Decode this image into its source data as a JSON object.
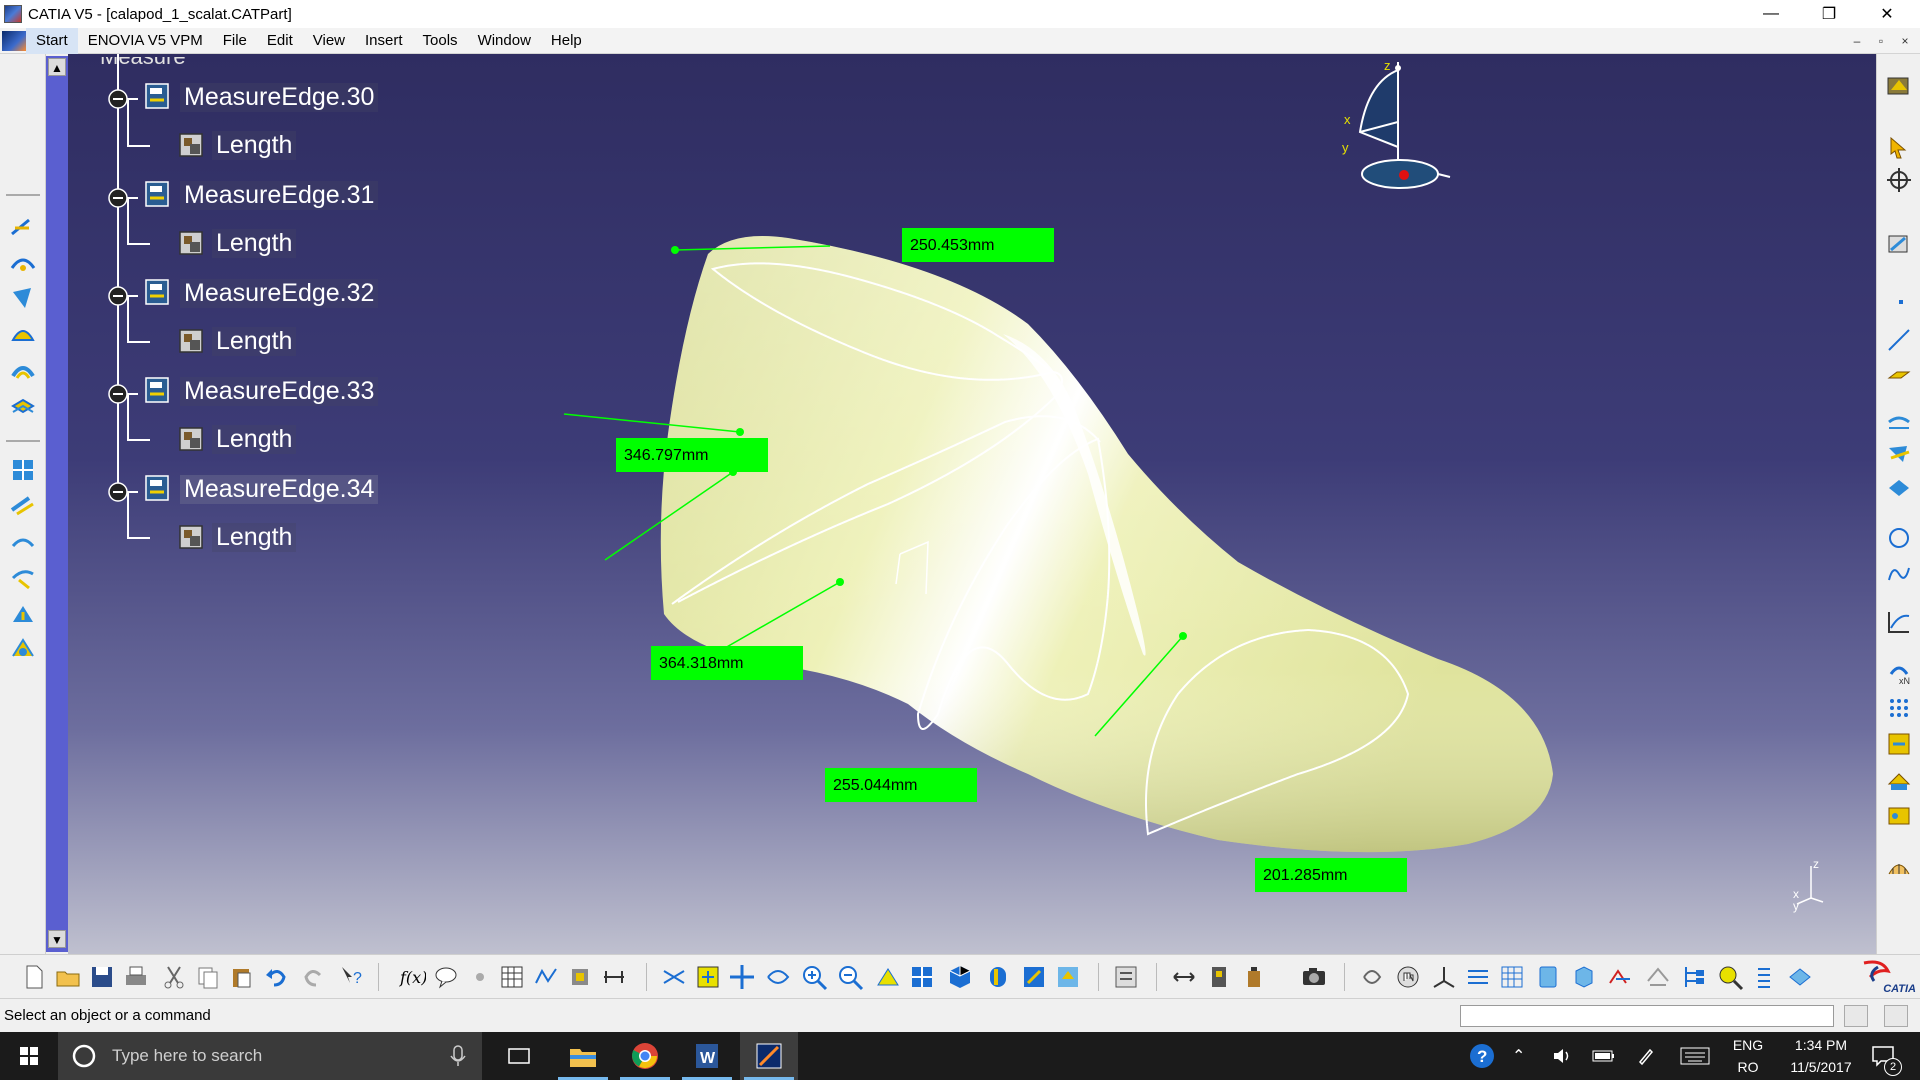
{
  "window": {
    "title": "CATIA V5 - [calapod_1_scalat.CATPart]",
    "controls": {
      "minimize": "—",
      "restore": "❐",
      "close": "✕"
    }
  },
  "menubar": {
    "items": [
      {
        "label": "Start",
        "active": true
      },
      {
        "label": "ENOVIA V5 VPM"
      },
      {
        "label": "File"
      },
      {
        "label": "Edit"
      },
      {
        "label": "View"
      },
      {
        "label": "Insert"
      },
      {
        "label": "Tools"
      },
      {
        "label": "Window"
      },
      {
        "label": "Help"
      }
    ],
    "doc_controls": {
      "minimize": "–",
      "restore": "▫",
      "close": "×"
    }
  },
  "spec_tree": {
    "partial_label": "Measure",
    "nodes": [
      {
        "label": "MeasureEdge.30",
        "child": "Length"
      },
      {
        "label": "MeasureEdge.31",
        "child": "Length"
      },
      {
        "label": "MeasureEdge.32",
        "child": "Length"
      },
      {
        "label": "MeasureEdge.33",
        "child": "Length"
      },
      {
        "label": "MeasureEdge.34",
        "child": "Length"
      }
    ]
  },
  "measurements": [
    {
      "value": "250.453mm"
    },
    {
      "value": "346.797mm"
    },
    {
      "value": "364.318mm"
    },
    {
      "value": "255.044mm"
    },
    {
      "value": "201.285mm"
    }
  ],
  "compass": {
    "x": "x",
    "y": "y",
    "z": "z"
  },
  "axis_triad": {
    "x": "x",
    "y": "y",
    "z": "z"
  },
  "colors": {
    "viewport_top": "#2f2d61",
    "viewport_bottom": "#bfc0cf",
    "part_surface": "#eef1b8",
    "measure_label": "#00ff00",
    "tree_scrollbar": "#5a5fd0"
  },
  "statusbar": {
    "text": "Select an object or a command",
    "command_value": ""
  },
  "taskbar": {
    "search_placeholder": "Type here to search",
    "language_top": "ENG",
    "language_bottom": "RO",
    "time": "1:34 PM",
    "date": "11/5/2017",
    "notifications": "2"
  },
  "brand": {
    "logo_text": "CATIA"
  }
}
